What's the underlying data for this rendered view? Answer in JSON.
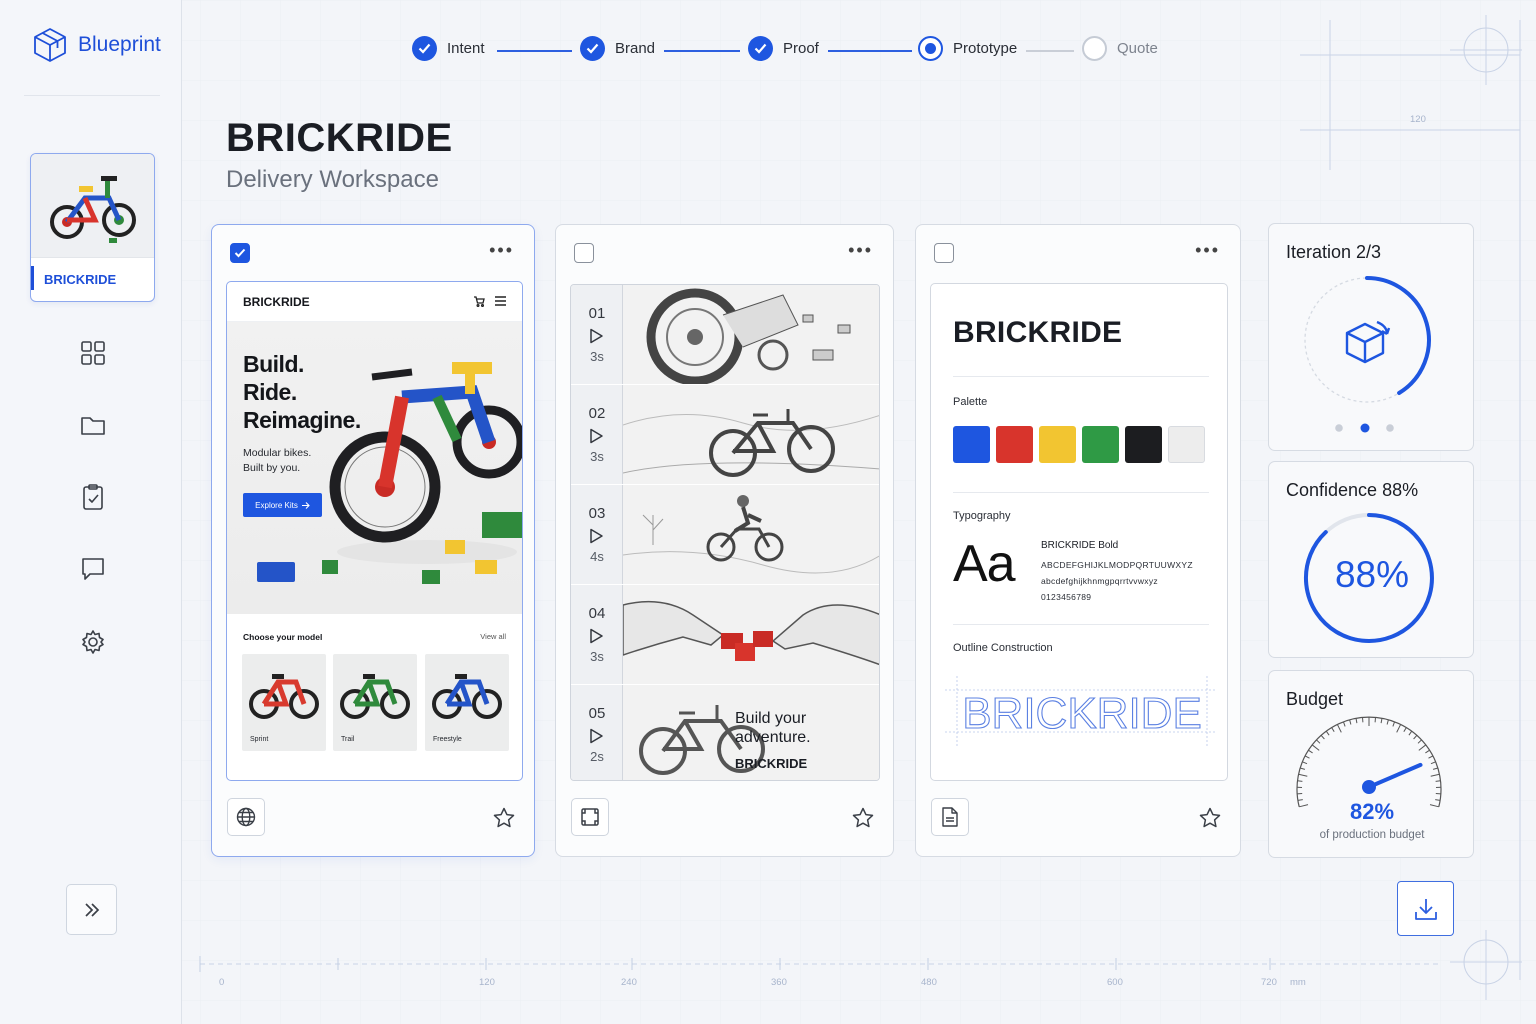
{
  "app": {
    "name": "Blueprint"
  },
  "sidebar": {
    "project": {
      "label": "BRICKRIDE"
    },
    "nav": [
      {
        "name": "grid-icon"
      },
      {
        "name": "folder-icon"
      },
      {
        "name": "clipboard-check-icon"
      },
      {
        "name": "chat-icon"
      },
      {
        "name": "gear-icon"
      }
    ],
    "expand_icon": "chevrons-right-icon"
  },
  "stepper": {
    "steps": [
      {
        "label": "Intent",
        "state": "done"
      },
      {
        "label": "Brand",
        "state": "done"
      },
      {
        "label": "Proof",
        "state": "done"
      },
      {
        "label": "Prototype",
        "state": "current"
      },
      {
        "label": "Quote",
        "state": "todo"
      }
    ]
  },
  "header": {
    "title": "BRICKRIDE",
    "subtitle": "Delivery Workspace"
  },
  "web_card": {
    "selected": true,
    "more": "•••",
    "brand": "BRICKRIDE",
    "hero_headline": [
      "Build.",
      "Ride.",
      "Reimagine."
    ],
    "hero_body": [
      "Modular bikes.",
      "Built by you."
    ],
    "cta": "Explore Kits",
    "section_title": "Choose your model",
    "view_all": "View all",
    "models": [
      {
        "name": "Sprint",
        "color": "#d83a2e"
      },
      {
        "name": "Trail",
        "color": "#2f8a3c"
      },
      {
        "name": "Freestyle",
        "color": "#2454c8"
      }
    ],
    "footer_icon": "globe-icon"
  },
  "storyboard_card": {
    "selected": false,
    "more": "•••",
    "frames": [
      {
        "num": "01",
        "dur": "3s"
      },
      {
        "num": "02",
        "dur": "3s"
      },
      {
        "num": "03",
        "dur": "4s"
      },
      {
        "num": "04",
        "dur": "3s"
      },
      {
        "num": "05",
        "dur": "2s"
      }
    ],
    "end_line1": "Build your",
    "end_line2": "adventure.",
    "end_brand": "BRICKRIDE",
    "footer_icon": "frame-icon"
  },
  "brand_card": {
    "selected": false,
    "more": "•••",
    "title": "BRICKRIDE",
    "palette_label": "Palette",
    "palette": [
      "#1e56e0",
      "#d8342c",
      "#f2c531",
      "#2f9a45",
      "#1c1d20",
      "#ededed"
    ],
    "typography_label": "Typography",
    "specimen": "Aa",
    "font_name": "BRICKRIDE Bold",
    "upper": "ABCDEFGHIJKLMODPQRTUUWXYZ",
    "lower": "abcdefghijkhnmgpqrrtvvwxyz",
    "digits": "0123456789",
    "outline_label": "Outline Construction",
    "outline_text": "BRICKRIDE",
    "footer_icon": "document-icon"
  },
  "metrics": {
    "iteration": {
      "title": "Iteration 2/3",
      "current": 2,
      "total": 3
    },
    "confidence": {
      "title": "Confidence 88%",
      "value": "88%",
      "fraction": 0.88
    },
    "budget": {
      "title": "Budget",
      "value": "82%",
      "caption": "of production budget",
      "fraction": 0.82
    }
  },
  "ruler": {
    "labels": [
      "0",
      "120",
      "240",
      "360",
      "480",
      "600",
      "720"
    ],
    "unit": "mm",
    "corner_label": "120"
  },
  "colors": {
    "accent": "#1e56e0"
  }
}
